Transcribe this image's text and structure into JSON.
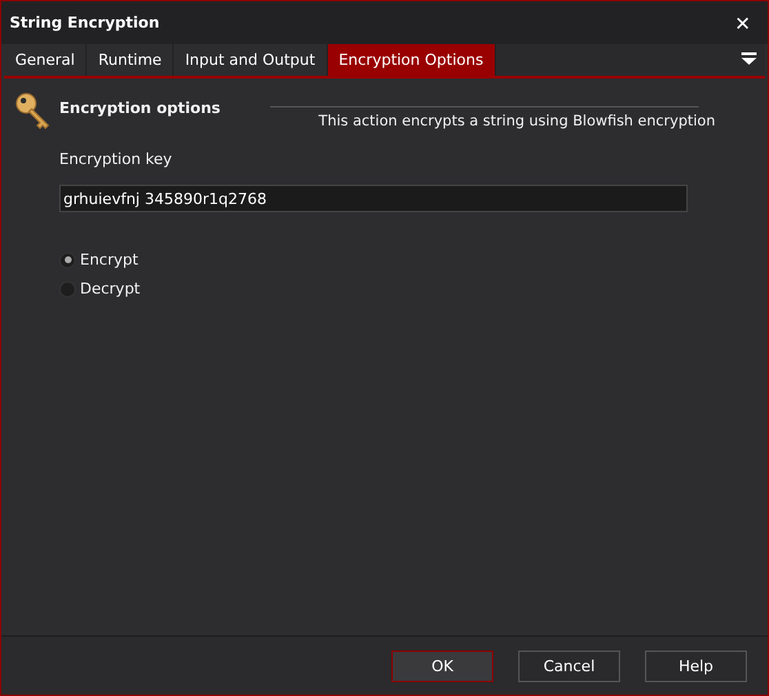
{
  "window": {
    "title": "String Encryption",
    "close": "✕"
  },
  "tabs": [
    {
      "label": "General",
      "selected": false
    },
    {
      "label": "Runtime",
      "selected": false
    },
    {
      "label": "Input and Output",
      "selected": false
    },
    {
      "label": "Encryption Options",
      "selected": true
    }
  ],
  "section": {
    "title": "Encryption options",
    "description": "This action encrypts a string using Blowfish encryption"
  },
  "key_field": {
    "label": "Encryption key",
    "value": "grhuievfnj 345890r1q2768"
  },
  "modes": [
    {
      "label": "Encrypt",
      "selected": true
    },
    {
      "label": "Decrypt",
      "selected": false
    }
  ],
  "buttons": [
    {
      "label": "OK",
      "default": true
    },
    {
      "label": "Cancel",
      "default": false
    },
    {
      "label": "Help",
      "default": false
    }
  ]
}
